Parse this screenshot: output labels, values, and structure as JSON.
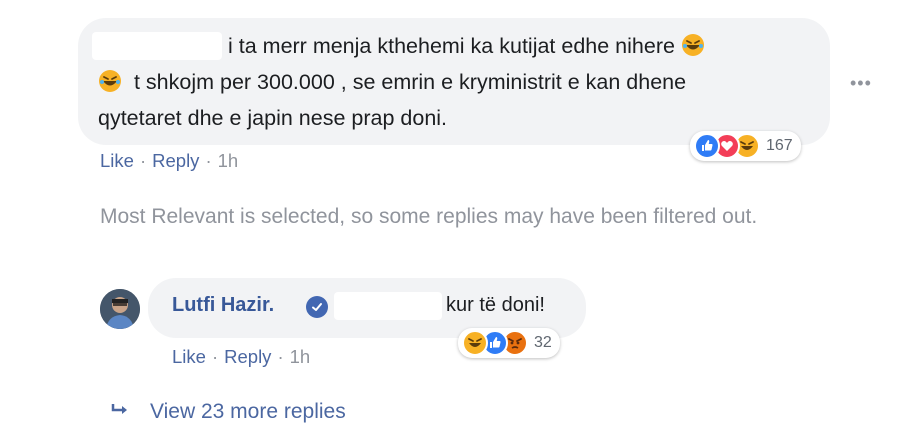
{
  "comment": {
    "line1": "i ta merr menja kthehemi ka kutijat edhe nihere",
    "line2": "t shkojm per 300.000 , se emrin e kryministrit e kan dhene",
    "line3": "qytetaret dhe e japin nese prap doni.",
    "reactions_count": "167",
    "actions": {
      "like": "Like",
      "reply": "Reply",
      "time": "1h",
      "sep": "·"
    },
    "more_options": "•••"
  },
  "filter_note": "Most Relevant is selected, so some replies may have been filtered out.",
  "reply": {
    "author": "Lutfi Hazir.",
    "text": "kur të doni!",
    "reactions_count": "32",
    "actions": {
      "like": "Like",
      "reply": "Reply",
      "time": "1h",
      "sep": "·"
    }
  },
  "view_more": "View 23 more replies",
  "colors": {
    "link": "#4b67a1",
    "name": "#385898",
    "muted": "#90949c",
    "bubble": "#f2f3f5",
    "like_blue": "#2f7cf6",
    "love_red": "#f33e58",
    "haha_yellow": "#f7b125",
    "angry_orange": "#e9710f"
  },
  "icons": [
    "laughing-emoji-icon",
    "like-reaction-icon",
    "love-reaction-icon",
    "haha-reaction-icon",
    "angry-reaction-icon",
    "verified-badge-icon",
    "reply-arrow-icon",
    "more-options-icon"
  ]
}
